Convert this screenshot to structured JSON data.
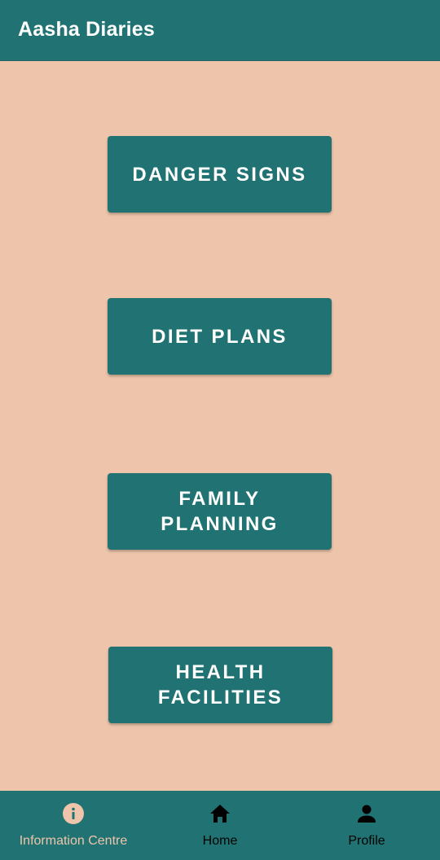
{
  "app_bar": {
    "title": "Aasha Diaries"
  },
  "menu": {
    "danger_signs": "DANGER SIGNS",
    "diet_plans": "DIET PLANS",
    "family_planning_line1": "FAMILY",
    "family_planning_line2": "PLANNING",
    "health_facilities_line1": "HEALTH",
    "health_facilities_line2": "FACILITIES"
  },
  "bottom_nav": {
    "items": [
      {
        "label": "Information Centre",
        "icon": "info-icon",
        "active": true
      },
      {
        "label": "Home",
        "icon": "home-icon",
        "active": false
      },
      {
        "label": "Profile",
        "icon": "person-icon",
        "active": false
      }
    ]
  },
  "colors": {
    "primary": "#217373",
    "background": "#EEC5AA",
    "active_nav": "#EEC5AA",
    "inactive_nav": "#000000"
  }
}
